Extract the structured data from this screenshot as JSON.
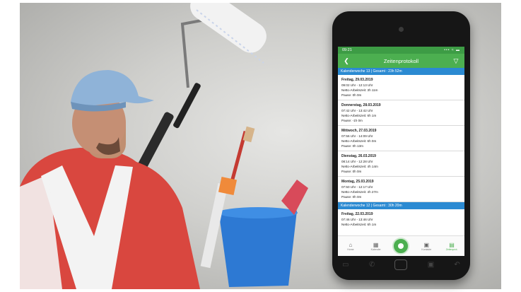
{
  "phone": {
    "status_time": "09:21",
    "status_icons": "••• ≈ ▬",
    "title": "Zeitenprotokoll",
    "back_icon": "chevron-left-icon",
    "filter_icon": "filter-icon",
    "weeks": [
      {
        "header": "Kalenderwoche 13 | Gesamt : 23h 52m",
        "entries": [
          {
            "date": "Freitag, 29.03.2019",
            "time": "09:02 Uhr - 12:13 Uhr",
            "net": "Netto-Arbeitszeit: 3h 11m",
            "pause": "Pause: 0h 0m"
          },
          {
            "date": "Donnerstag, 28.03.2019",
            "time": "07:42 Uhr - 13:42 Uhr",
            "net": "Netto-Arbeitszeit: 6h 1m",
            "pause": "Pause: -1h 0m"
          },
          {
            "date": "Mittwoch, 27.03.2019",
            "time": "07:56 Uhr - 14:09 Uhr",
            "net": "Netto-Arbeitszeit: 6h 0m",
            "pause": "Pause: 0h 13m"
          },
          {
            "date": "Dienstag, 26.03.2019",
            "time": "08:14 Uhr - 12:28 Uhr",
            "net": "Netto-Arbeitszeit: 4h 14m",
            "pause": "Pause: 0h 0m"
          },
          {
            "date": "Montag, 25.03.2019",
            "time": "07:50 Uhr - 12:17 Uhr",
            "net": "Netto-Arbeitszeit: 4h 27m",
            "pause": "Pause: 0h 0m"
          }
        ]
      },
      {
        "header": "Kalenderwoche 12 | Gesamt : 30h 20m",
        "entries": [
          {
            "date": "Freitag, 22.03.2019",
            "time": "07:46 Uhr - 13:46 Uhr",
            "net": "Netto-Arbeitszeit: 6h 1m",
            "pause": ""
          }
        ]
      }
    ],
    "nav": [
      {
        "label": "Home",
        "icon": "home-icon",
        "glyph": "⌂"
      },
      {
        "label": "Kalender",
        "icon": "calendar-icon",
        "glyph": "▦"
      },
      {
        "label": "Stempeln",
        "icon": "stamp-icon",
        "glyph": ""
      },
      {
        "label": "Kontakte",
        "icon": "contacts-icon",
        "glyph": "▣"
      },
      {
        "label": "Zeitenprot.",
        "icon": "time-log-icon",
        "glyph": "▤"
      }
    ]
  },
  "colors": {
    "appbar": "#4caf50",
    "statusbar": "#3d9c45",
    "week_header": "#2b8ad2",
    "shirt": "#d9473f",
    "cap": "#8fb3d8",
    "bucket": "#2d79d3"
  }
}
